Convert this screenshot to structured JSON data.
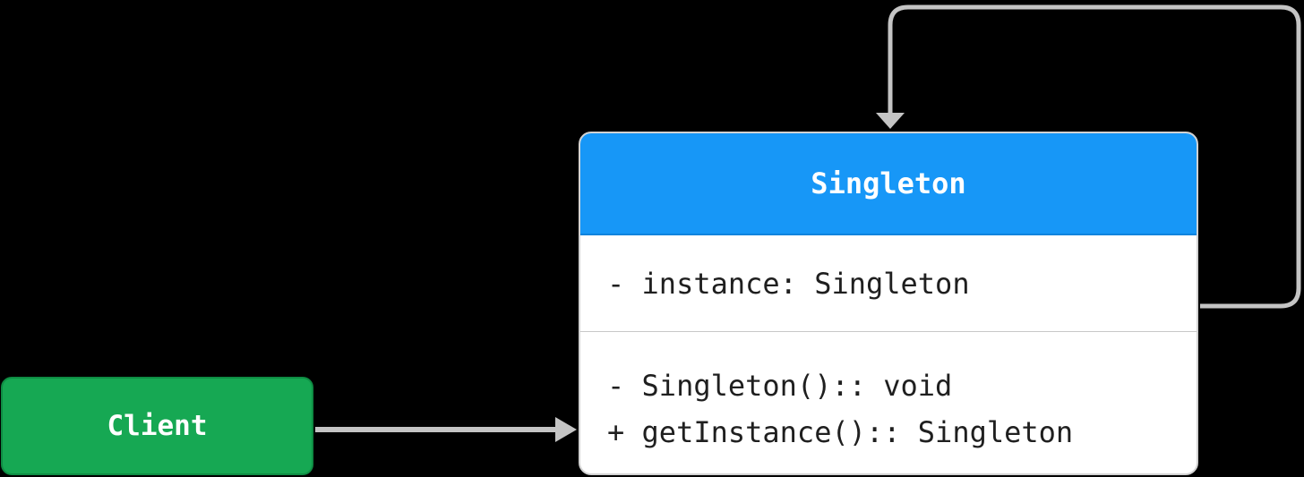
{
  "diagram": {
    "client": {
      "label": "Client"
    },
    "singleton": {
      "name": "Singleton",
      "attributes": [
        "- instance: Singleton"
      ],
      "methods": [
        "- Singleton():: void",
        "+ getInstance():: Singleton"
      ]
    },
    "colors": {
      "background": "#000000",
      "client_fill": "#16a853",
      "header_fill": "#1797f7",
      "body_fill": "#ffffff",
      "connector": "#c4c4c4"
    },
    "edges": [
      {
        "from": "client",
        "to": "singleton",
        "style": "arrow"
      },
      {
        "from": "singleton",
        "to": "singleton",
        "style": "self-loop arrow"
      }
    ]
  }
}
